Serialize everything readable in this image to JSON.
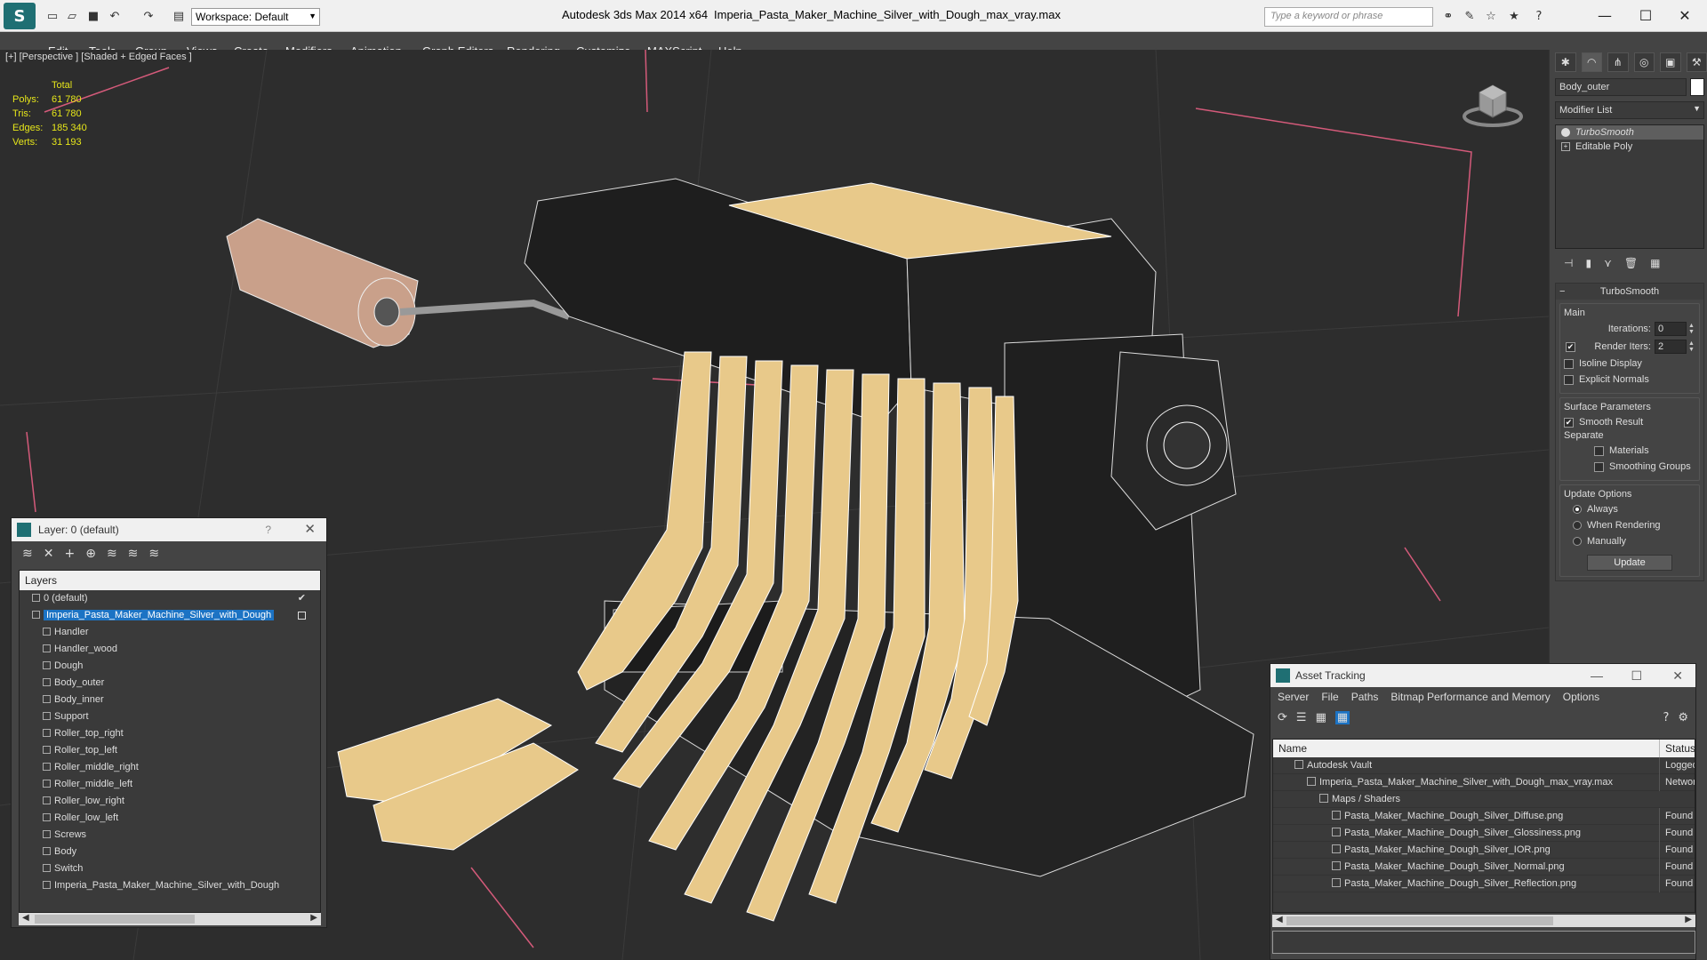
{
  "app": {
    "title": "Autodesk 3ds Max  2014 x64",
    "file": "Imperia_Pasta_Maker_Machine_Silver_with_Dough_max_vray.max",
    "workspace": "Workspace: Default",
    "search_placeholder": "Type a keyword or phrase"
  },
  "menu": [
    "Edit",
    "Tools",
    "Group",
    "Views",
    "Create",
    "Modifiers",
    "Animation",
    "Graph Editors",
    "Rendering",
    "Customize",
    "MAXScript",
    "Help"
  ],
  "viewport": {
    "label": "[+] [Perspective ] [Shaded + Edged Faces ]",
    "stats": {
      "header": "Total",
      "polys_label": "Polys:",
      "polys": "61 780",
      "tris_label": "Tris:",
      "tris": "61 780",
      "edges_label": "Edges:",
      "edges": "185 340",
      "verts_label": "Verts:",
      "verts": "31 193"
    }
  },
  "command_panel": {
    "object_name": "Body_outer",
    "modifier_list": "Modifier List",
    "stack": [
      "TurboSmooth",
      "Editable Poly"
    ],
    "rollout": "TurboSmooth",
    "main": {
      "title": "Main",
      "iterations_label": "Iterations:",
      "iterations": "0",
      "render_iters_label": "Render Iters:",
      "render_iters": "2",
      "isoline": "Isoline Display",
      "explicit": "Explicit Normals"
    },
    "surface": {
      "title": "Surface Parameters",
      "smooth": "Smooth Result",
      "separate": "Separate",
      "materials": "Materials",
      "smoothing": "Smoothing Groups"
    },
    "update": {
      "title": "Update Options",
      "always": "Always",
      "when_rendering": "When Rendering",
      "manually": "Manually",
      "button": "Update"
    }
  },
  "layer_window": {
    "title": "Layer: 0 (default)",
    "help": "?",
    "header": "Layers",
    "rows": [
      {
        "label": "0 (default)",
        "level": 1
      },
      {
        "label": "Imperia_Pasta_Maker_Machine_Silver_with_Dough",
        "level": 1
      },
      {
        "label": "Handler",
        "level": 2
      },
      {
        "label": "Handler_wood",
        "level": 2
      },
      {
        "label": "Dough",
        "level": 2
      },
      {
        "label": "Body_outer",
        "level": 2
      },
      {
        "label": "Body_inner",
        "level": 2
      },
      {
        "label": "Support",
        "level": 2
      },
      {
        "label": "Roller_top_right",
        "level": 2
      },
      {
        "label": "Roller_top_left",
        "level": 2
      },
      {
        "label": "Roller_middle_right",
        "level": 2
      },
      {
        "label": "Roller_middle_left",
        "level": 2
      },
      {
        "label": "Roller_low_right",
        "level": 2
      },
      {
        "label": "Roller_low_left",
        "level": 2
      },
      {
        "label": "Screws",
        "level": 2
      },
      {
        "label": "Body",
        "level": 2
      },
      {
        "label": "Switch",
        "level": 2
      },
      {
        "label": "Imperia_Pasta_Maker_Machine_Silver_with_Dough",
        "level": 2
      }
    ]
  },
  "asset_window": {
    "title": "Asset Tracking",
    "menu": [
      "Server",
      "File",
      "Paths",
      "Bitmap Performance and Memory",
      "Options"
    ],
    "col_name": "Name",
    "col_status": "Status",
    "rows": [
      {
        "name": "Autodesk Vault",
        "status": "Logged",
        "indent": 1
      },
      {
        "name": "Imperia_Pasta_Maker_Machine_Silver_with_Dough_max_vray.max",
        "status": "Networ",
        "indent": 2
      },
      {
        "name": "Maps / Shaders",
        "status": "",
        "indent": 3
      },
      {
        "name": "Pasta_Maker_Machine_Dough_Silver_Diffuse.png",
        "status": "Found",
        "indent": 4
      },
      {
        "name": "Pasta_Maker_Machine_Dough_Silver_Glossiness.png",
        "status": "Found",
        "indent": 4
      },
      {
        "name": "Pasta_Maker_Machine_Dough_Silver_IOR.png",
        "status": "Found",
        "indent": 4
      },
      {
        "name": "Pasta_Maker_Machine_Dough_Silver_Normal.png",
        "status": "Found",
        "indent": 4
      },
      {
        "name": "Pasta_Maker_Machine_Dough_Silver_Reflection.png",
        "status": "Found",
        "indent": 4
      }
    ]
  },
  "colors": {
    "viewport_bg": "#2d2d2d",
    "stats_text": "#e6e61a",
    "selection": "#1c73c4",
    "dough": "#e8c98a",
    "body": "#1e1e1e"
  }
}
